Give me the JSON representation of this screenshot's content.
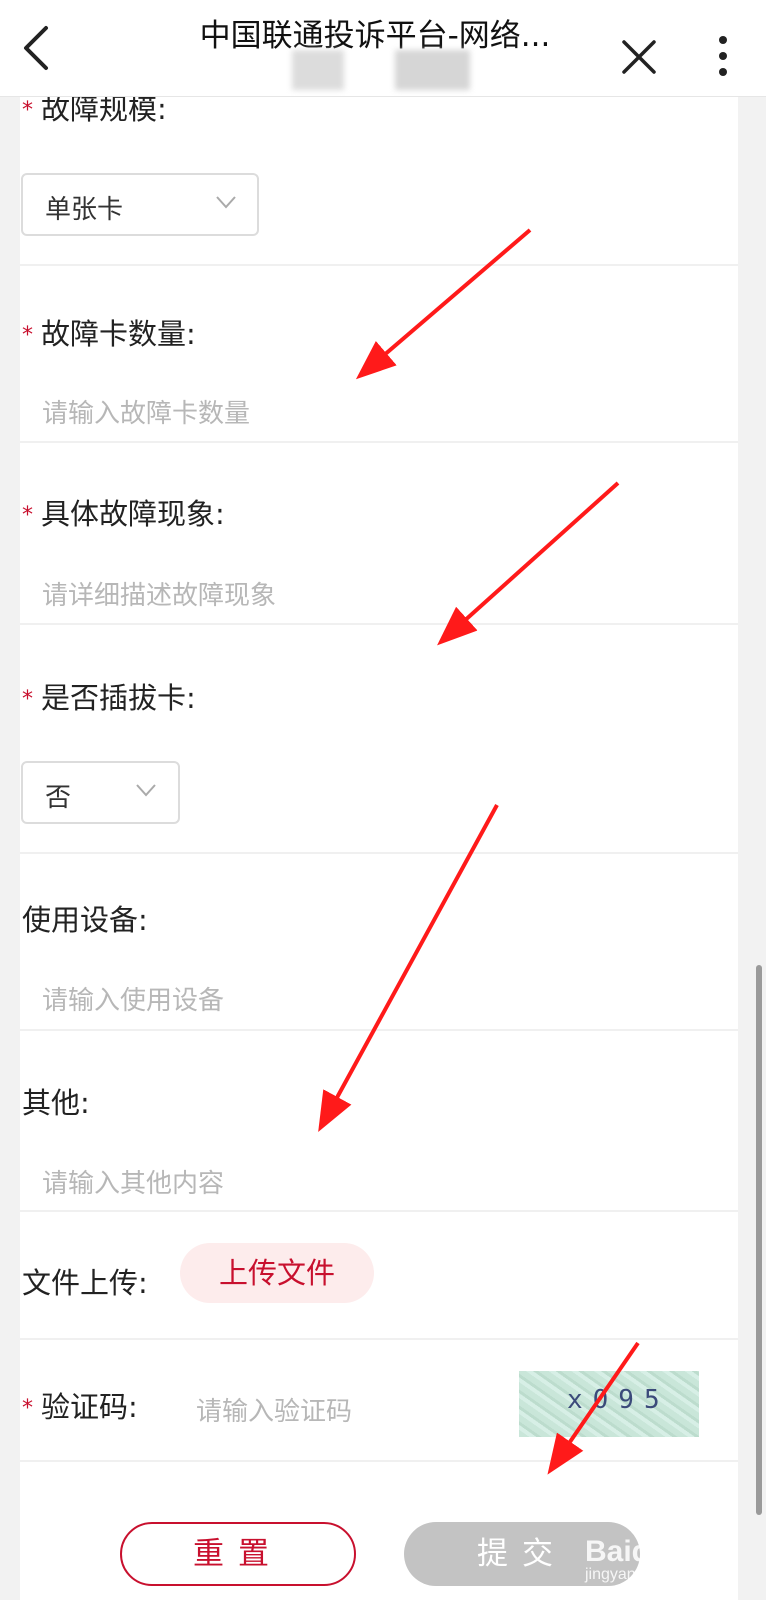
{
  "topbar": {
    "title": "中国联通投诉平台-网络...",
    "back_icon": "chevron-left-icon",
    "close_icon": "close-icon",
    "more_icon": "more-vertical-icon"
  },
  "form": {
    "required_mark": "*",
    "fault_scale": {
      "label": "故障规模:",
      "value": "单张卡"
    },
    "fault_card_count": {
      "label": "故障卡数量:",
      "placeholder": "请输入故障卡数量"
    },
    "fault_symptom": {
      "label": "具体故障现象:",
      "placeholder": "请详细描述故障现象"
    },
    "card_reinserted": {
      "label": "是否插拔卡:",
      "value": "否"
    },
    "device": {
      "label": "使用设备:",
      "placeholder": "请输入使用设备"
    },
    "other": {
      "label": "其他:",
      "placeholder": "请输入其他内容"
    },
    "file_upload": {
      "label": "文件上传:",
      "button": "上传文件"
    },
    "captcha": {
      "label": "验证码:",
      "placeholder": "请输入验证码",
      "image_text": "x095"
    }
  },
  "actions": {
    "reset": "重置",
    "submit": "提交"
  },
  "watermark": {
    "main": "Baidu经验",
    "sub": "jingyan.baidu.com"
  },
  "colors": {
    "accent": "#c8102e",
    "arrow": "#ff1a1a",
    "disabled": "#c3c3c3"
  }
}
